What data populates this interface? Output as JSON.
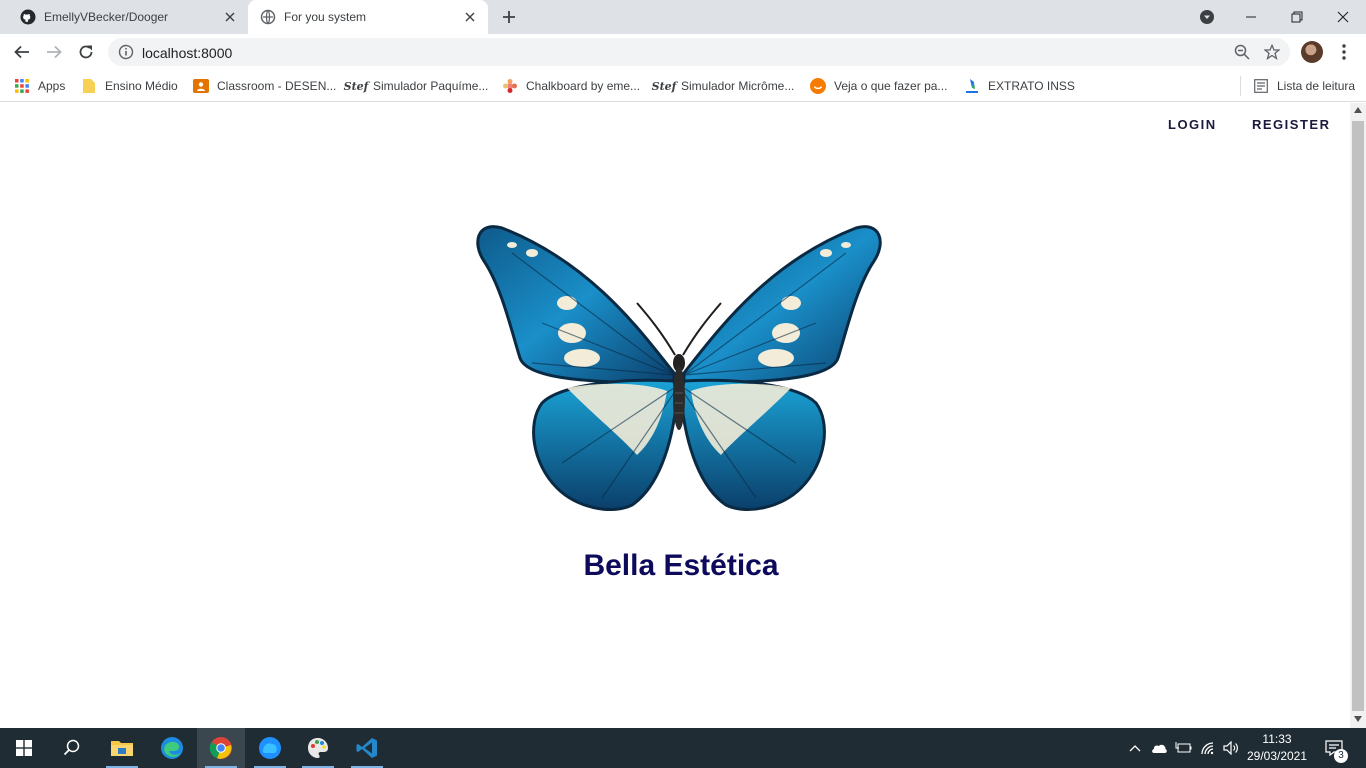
{
  "browser": {
    "tabs": [
      {
        "title": "EmellyVBecker/Dooger",
        "icon": "github-icon"
      },
      {
        "title": "For you system",
        "icon": "globe-icon"
      }
    ],
    "url": "localhost:8000",
    "bookmarks": [
      {
        "label": "Apps",
        "icon": "apps-grid-icon"
      },
      {
        "label": "Ensino Médio",
        "icon": "folder-icon"
      },
      {
        "label": "Classroom - DESEN...",
        "icon": "classroom-icon"
      },
      {
        "label": "Simulador Paquíme...",
        "icon": "stef-icon"
      },
      {
        "label": "Chalkboard by eme...",
        "icon": "chalkboard-icon"
      },
      {
        "label": "Simulador Micrôme...",
        "icon": "stef-icon"
      },
      {
        "label": "Veja o que fazer pa...",
        "icon": "orange-circle-icon"
      },
      {
        "label": "EXTRATO INSS",
        "icon": "inss-icon"
      }
    ],
    "reading_list": "Lista de leitura",
    "stef_glyph": "Stef"
  },
  "page": {
    "nav": {
      "login": "LOGIN",
      "register": "REGISTER"
    },
    "brand_name": "Bella Estética"
  },
  "taskbar": {
    "time": "11:33",
    "date": "29/03/2021",
    "notifications": "3"
  },
  "colors": {
    "brand_text": "#0d0a5c",
    "nav_text": "#1a1a3e",
    "butterfly_blue": "#1a8fc9",
    "butterfly_cream": "#f2ecd8",
    "taskbar_bg": "#202c33"
  }
}
